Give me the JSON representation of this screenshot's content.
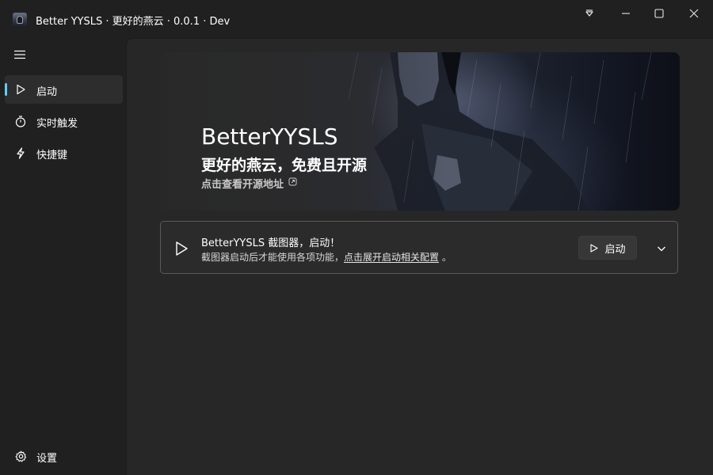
{
  "window": {
    "title": "Better YYSLS · 更好的燕云 · 0.0.1 · Dev",
    "controls": [
      "dropdown-icon",
      "minimize-icon",
      "maximize-icon",
      "close-icon"
    ]
  },
  "sidebar": {
    "menu_icon": "hamburger-icon",
    "items": [
      {
        "label": "启动",
        "icon": "play-icon",
        "active": true
      },
      {
        "label": "实时触发",
        "icon": "timer-icon",
        "active": false
      },
      {
        "label": "快捷键",
        "icon": "lightning-icon",
        "active": false
      }
    ],
    "footer": {
      "label": "设置",
      "icon": "gear-icon"
    }
  },
  "hero": {
    "title": "BetterYYSLS",
    "subtitle": "更好的燕云，免费且开源",
    "link_text": "点击查看开源地址"
  },
  "launch_card": {
    "title": "BetterYYSLS 截图器，启动！",
    "desc_prefix": "截图器启动后才能使用各项功能，",
    "desc_link": "点击展开启动相关配置",
    "desc_suffix": "。",
    "button_label": "启动"
  },
  "colors": {
    "accent": "#60cdff",
    "background": "#202020",
    "content": "#272727"
  }
}
